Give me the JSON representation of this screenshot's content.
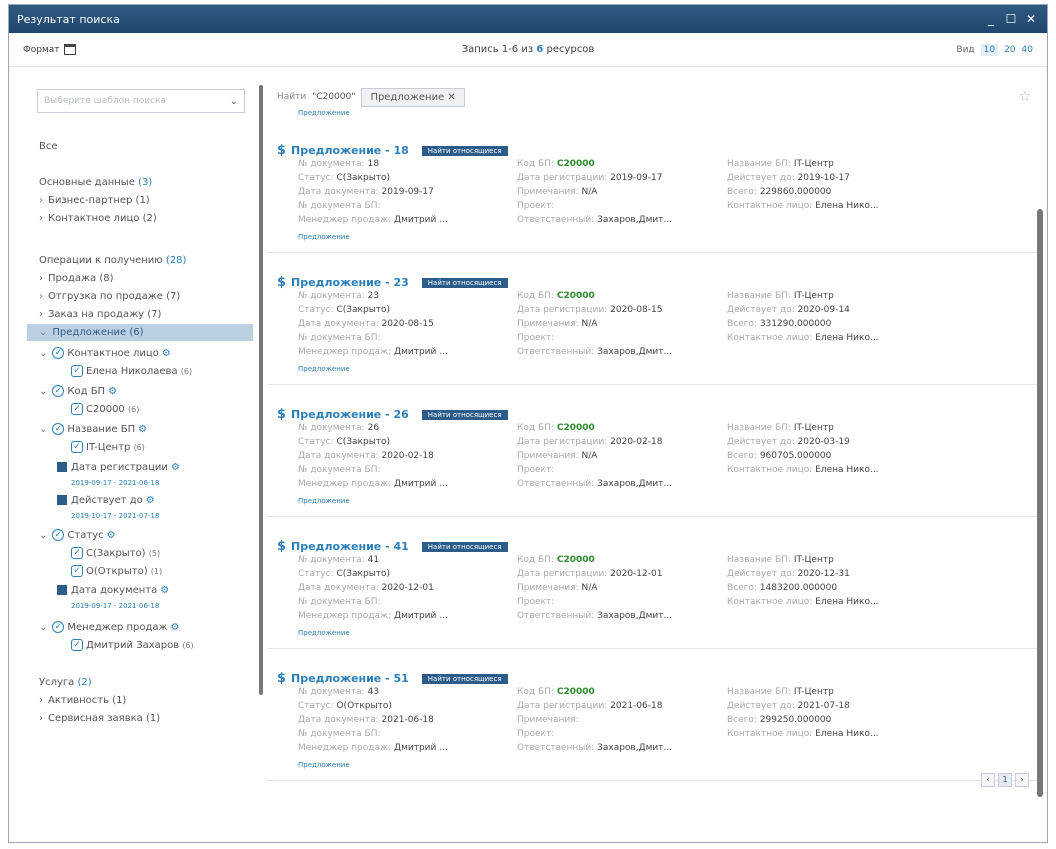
{
  "window": {
    "title": "Результат поиска",
    "min": "_",
    "max": "☐",
    "close": "✕"
  },
  "toolbar": {
    "format_label": "Формат",
    "records_prefix": "Запись 1-6 из",
    "records_count": "6",
    "records_suffix": "ресурсов",
    "view_label": "Вид",
    "view_options": [
      "10",
      "20",
      "40"
    ]
  },
  "search": {
    "find_label": "Найти",
    "query": "\"C20000\"",
    "chip": "Предложение ✕"
  },
  "left": {
    "template_placeholder": "Выберите шаблон поиска",
    "all": "Все",
    "basic": "Основные данные",
    "basic_cnt": "(3)",
    "bp": "Бизнес-партнер",
    "bp_cnt": "(1)",
    "contact": "Контактное лицо",
    "contact_cnt": "(2)",
    "ops": "Операции к получению",
    "ops_cnt": "(28)",
    "sale": "Продажа",
    "sale_cnt": "(8)",
    "ship": "Отгрузка по продаже",
    "ship_cnt": "(7)",
    "order": "Заказ на продажу",
    "order_cnt": "(7)",
    "offer": "Предложение",
    "offer_cnt": "(6)",
    "f_contact": "Контактное лицо",
    "f_contact_v": "Елена Николаева",
    "f_contact_v_cnt": "(6)",
    "f_code": "Код БП",
    "f_code_v": "C20000",
    "f_code_v_cnt": "(6)",
    "f_name": "Название БП",
    "f_name_v": "IT-Центр",
    "f_name_v_cnt": "(6)",
    "f_regdate": "Дата регистрации",
    "f_regdate_range": "2019-09-17 - 2021-06-18",
    "f_valid": "Действует до",
    "f_valid_range": "2019-10-17 - 2021-07-18",
    "f_status": "Статус",
    "f_status_v1": "C(Закрыто)",
    "f_status_v1_cnt": "(5)",
    "f_status_v2": "O(Открыто)",
    "f_status_v2_cnt": "(1)",
    "f_docdate": "Дата документа",
    "f_docdate_range": "2019-09-17 - 2021-06-18",
    "f_mgr": "Менеджер продаж",
    "f_mgr_v": "Дмитрий Захаров",
    "f_mgr_v_cnt": "(6)",
    "service": "Услуга",
    "service_cnt": "(2)",
    "activity": "Активность",
    "activity_cnt": "(1)",
    "service_req": "Сервисная заявка",
    "service_req_cnt": "(1)"
  },
  "labels": {
    "docnum": "№ документа:",
    "status": "Статус:",
    "docdate": "Дата документа:",
    "bpdoc": "№ документа БП:",
    "mgr": "Менеджер продаж:",
    "code": "Код БП:",
    "regdate": "Дата регистрации:",
    "note": "Примечания:",
    "project": "Проект:",
    "resp": "Ответственный:",
    "bpname": "Название БП:",
    "valid": "Действует до:",
    "total": "Всего:",
    "contact": "Контактное лицо:",
    "tag": "Предложение",
    "badge": "Найти относящиеся"
  },
  "top_tag": "Предложение",
  "results": [
    {
      "title": "Предложение - 18",
      "docnum": "18",
      "status": "C(Закрыто)",
      "docdate": "2019-09-17",
      "mgr": "Дмитрий ...",
      "code": "C20000",
      "regdate": "2019-09-17",
      "note": "N/A",
      "resp": "Захаров,Дмит...",
      "bpname": "IT-Центр",
      "valid": "2019-10-17",
      "total": "229860.000000",
      "contact": "Елена Нико..."
    },
    {
      "title": "Предложение - 23",
      "docnum": "23",
      "status": "C(Закрыто)",
      "docdate": "2020-08-15",
      "mgr": "Дмитрий ...",
      "code": "C20000",
      "regdate": "2020-08-15",
      "note": "N/A",
      "resp": "Захаров,Дмит...",
      "bpname": "IT-Центр",
      "valid": "2020-09-14",
      "total": "331290.000000",
      "contact": "Елена Нико..."
    },
    {
      "title": "Предложение - 26",
      "docnum": "26",
      "status": "C(Закрыто)",
      "docdate": "2020-02-18",
      "mgr": "Дмитрий ...",
      "code": "C20000",
      "regdate": "2020-02-18",
      "note": "N/A",
      "resp": "Захаров,Дмит...",
      "bpname": "IT-Центр",
      "valid": "2020-03-19",
      "total": "960705.000000",
      "contact": "Елена Нико..."
    },
    {
      "title": "Предложение - 41",
      "docnum": "41",
      "status": "C(Закрыто)",
      "docdate": "2020-12-01",
      "mgr": "Дмитрий ...",
      "code": "C20000",
      "regdate": "2020-12-01",
      "note": "N/A",
      "resp": "Захаров,Дмит...",
      "bpname": "IT-Центр",
      "valid": "2020-12-31",
      "total": "1483200.000000",
      "contact": "Елена Нико..."
    },
    {
      "title": "Предложение - 51",
      "docnum": "43",
      "status": "O(Открыто)",
      "docdate": "2021-06-18",
      "mgr": "Дмитрий ...",
      "code": "C20000",
      "regdate": "2021-06-18",
      "note": "",
      "resp": "Захаров,Дмит...",
      "bpname": "IT-Центр",
      "valid": "2021-07-18",
      "total": "299250.000000",
      "contact": "Елена Нико..."
    }
  ],
  "pager": {
    "current": "1"
  }
}
